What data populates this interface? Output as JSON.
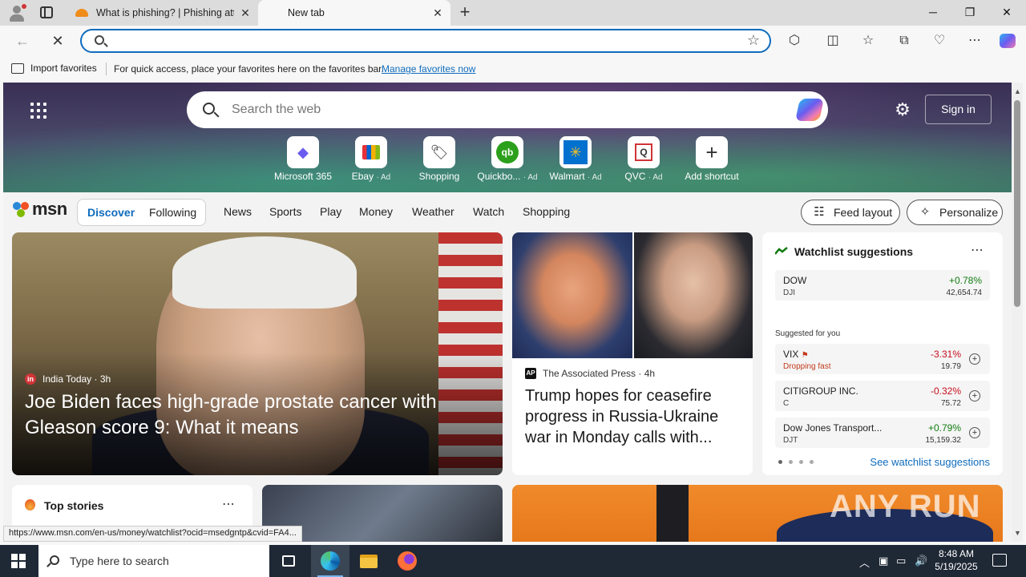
{
  "browser": {
    "tabs": [
      {
        "title": "What is phishing? | Phishing attacks",
        "active": false
      },
      {
        "title": "New tab",
        "active": true
      }
    ],
    "address": {
      "value": "",
      "placeholder": ""
    },
    "favorites_bar": {
      "import_label": "Import favorites",
      "hint": "For quick access, place your favorites here on the favorites bar.",
      "manage_link": "Manage favorites now"
    },
    "status_url": "https://www.msn.com/en-us/money/watchlist?ocid=msedgntp&cvid=FA4..."
  },
  "newtab": {
    "search_placeholder": "Search the web",
    "sign_in": "Sign in",
    "shortcuts": [
      {
        "label": "Microsoft 365",
        "ad": "",
        "icon": "microsoft-365-icon",
        "color": "#6b5cf0"
      },
      {
        "label": "Ebay",
        "ad": "· Ad",
        "icon": "ebay-bag-icon",
        "color": "#e53238"
      },
      {
        "label": "Shopping",
        "ad": "",
        "icon": "shopping-tag-icon",
        "color": "#333333"
      },
      {
        "label": "Quickbo...",
        "ad": "· Ad",
        "icon": "quickbooks-icon",
        "color": "#2ca01c"
      },
      {
        "label": "Walmart",
        "ad": "· Ad",
        "icon": "walmart-icon",
        "color": "#0071ce"
      },
      {
        "label": "QVC",
        "ad": "· Ad",
        "icon": "qvc-icon",
        "color": "#d13438"
      },
      {
        "label": "Add shortcut",
        "ad": "",
        "icon": "plus-icon",
        "color": "#333333"
      }
    ]
  },
  "msn": {
    "logo_text": "msn",
    "discover": "Discover",
    "following": "Following",
    "nav": [
      "News",
      "Sports",
      "Play",
      "Money",
      "Weather",
      "Watch",
      "Shopping"
    ],
    "feed_layout": "Feed layout",
    "personalize": "Personalize"
  },
  "feed": {
    "main": {
      "source": "India Today",
      "age": "· 3h",
      "headline": "Joe Biden faces high-grade prostate cancer with Gleason score 9: What it means"
    },
    "second": {
      "source": "The Associated Press",
      "age": "· 4h",
      "headline": "Trump hopes for ceasefire progress in Russia-Ukraine war in Monday calls with..."
    },
    "top_stories": "Top stories"
  },
  "watchlist": {
    "title": "Watchlist suggestions",
    "suggested_for_you": "Suggested for you",
    "see_all": "See watchlist suggestions",
    "items": [
      {
        "name": "DOW",
        "symbol": "DJI",
        "change": "+0.78%",
        "price": "42,654.74",
        "color": "#107c10",
        "flag": ""
      },
      {
        "name": "VIX",
        "symbol": "Dropping fast",
        "change": "-3.31%",
        "price": "19.79",
        "color": "#c50f1f",
        "flag": "Dropping fast"
      },
      {
        "name": "CITIGROUP INC.",
        "symbol": "C",
        "change": "-0.32%",
        "price": "75.72",
        "color": "#c50f1f",
        "flag": ""
      },
      {
        "name": "Dow Jones Transport...",
        "symbol": "DJT",
        "change": "+0.79%",
        "price": "15,159.32",
        "color": "#107c10",
        "flag": ""
      }
    ]
  },
  "watermark": "ANY RUN",
  "taskbar": {
    "search_placeholder": "Type here to search",
    "time": "8:48 AM",
    "date": "5/19/2025"
  }
}
